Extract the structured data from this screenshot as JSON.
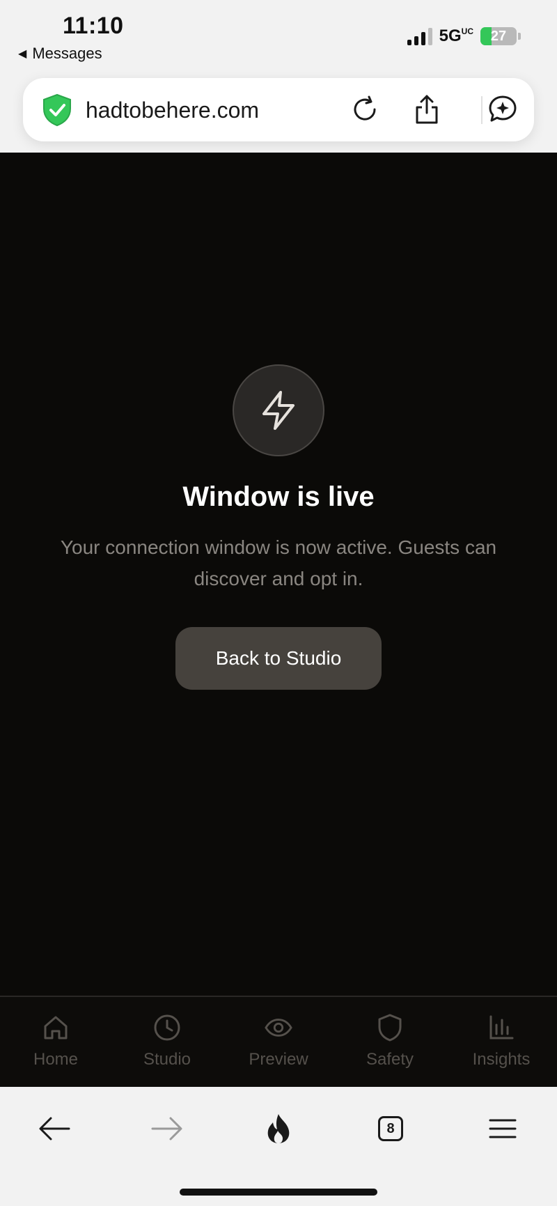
{
  "status_bar": {
    "time": "11:10",
    "back_app": "Messages",
    "network": "5G",
    "network_suffix": "UC",
    "battery_level": "27"
  },
  "url_bar": {
    "domain": "hadtobehere.com",
    "shield_color": "#34c759"
  },
  "main": {
    "icon": "lightning-bolt-icon",
    "title": "Window is live",
    "subtitle": "Your connection window is now active. Guests can discover and opt in.",
    "cta_label": "Back to Studio"
  },
  "app_tabs": [
    {
      "label": "Home",
      "icon": "home-icon"
    },
    {
      "label": "Studio",
      "icon": "clock-icon"
    },
    {
      "label": "Preview",
      "icon": "eye-icon"
    },
    {
      "label": "Safety",
      "icon": "shield-icon"
    },
    {
      "label": "Insights",
      "icon": "bar-chart-icon"
    }
  ],
  "browser_toolbar": {
    "tab_count": "8"
  },
  "colors": {
    "content_bg": "#0b0a08",
    "cta_bg": "#46423d",
    "tab_inactive": "#55514c"
  }
}
